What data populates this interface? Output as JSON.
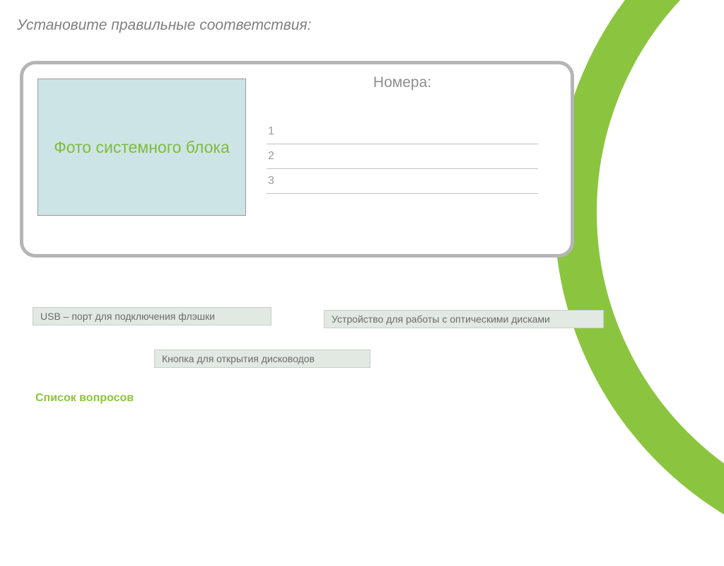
{
  "title": "Установите правильные соответствия:",
  "card": {
    "photo_label": "Фото системного блока",
    "numbers_title": "Номера:",
    "rows": [
      "1",
      "2",
      "3"
    ]
  },
  "chips": {
    "usb": "USB – порт для подключения флэшки",
    "optical": "Устройство для работы с оптическими дисками",
    "eject": "Кнопка для открытия дисководов"
  },
  "footer_link": "Список вопросов"
}
